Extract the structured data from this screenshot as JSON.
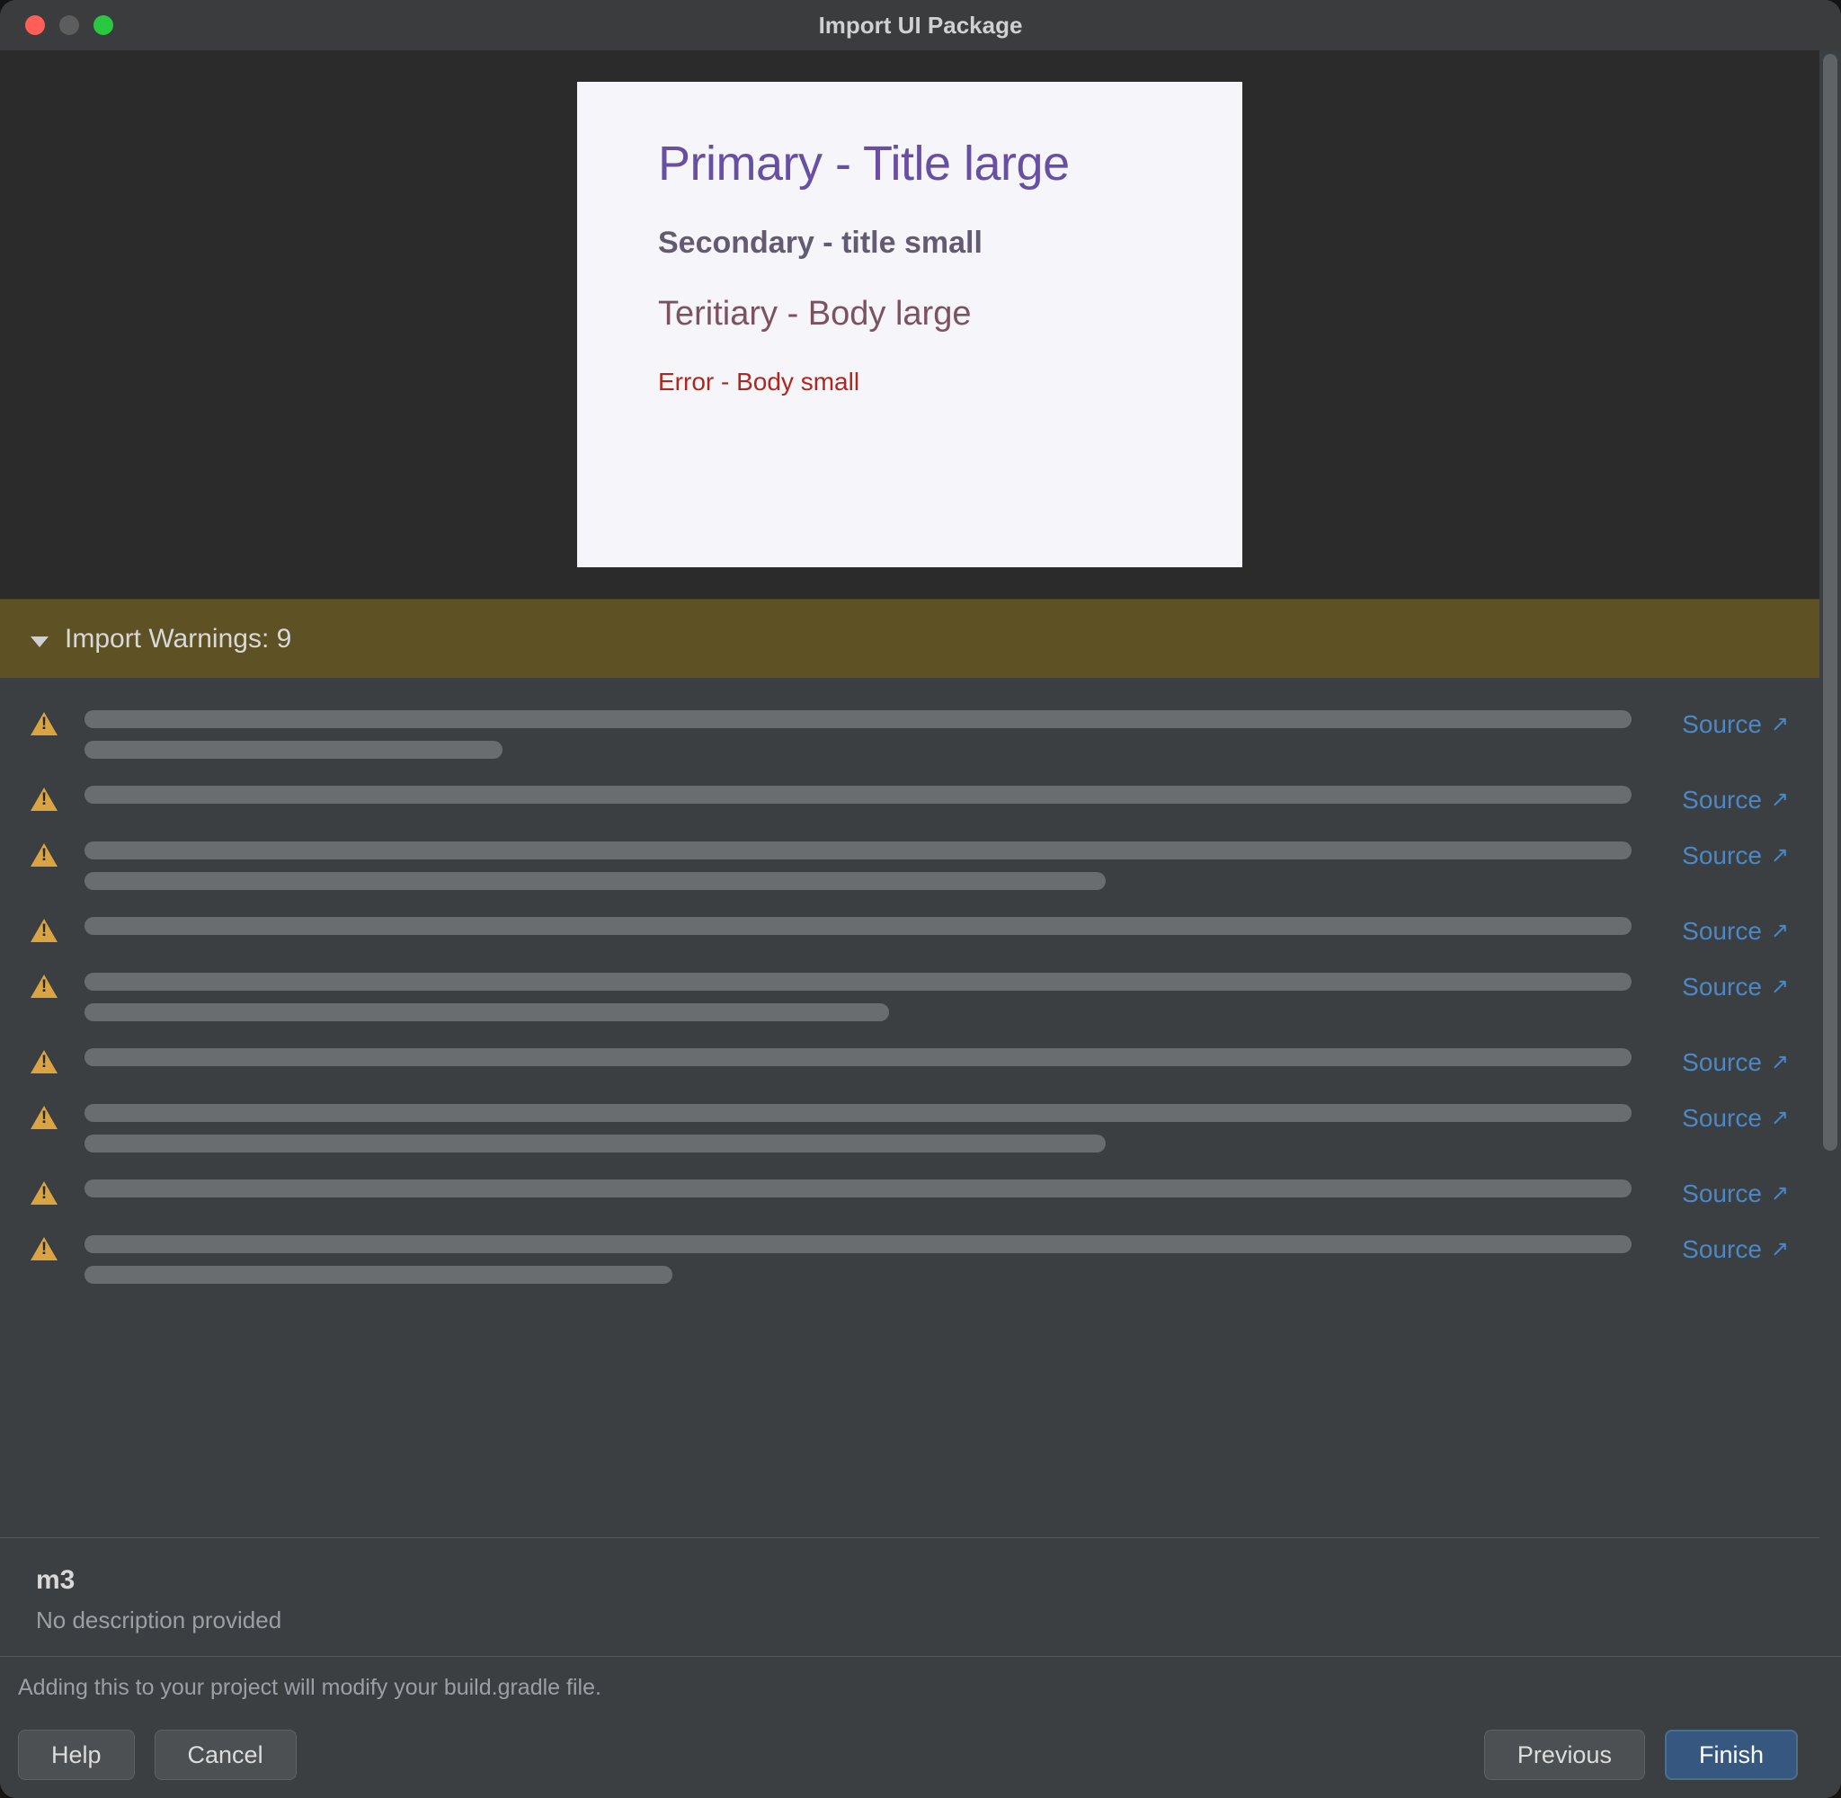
{
  "window": {
    "title": "Import UI Package"
  },
  "preview": {
    "primary": "Primary - Title large",
    "secondary": "Secondary - title small",
    "tertiary": "Teritiary - Body large",
    "error": "Error - Body small"
  },
  "warnings": {
    "banner_label": "Import Warnings: 9",
    "source_label": "Source",
    "items": [
      {
        "lines": [
          "rl-full",
          "rl-22"
        ]
      },
      {
        "lines": [
          "rl-full"
        ]
      },
      {
        "lines": [
          "rl-full",
          "rl-62"
        ]
      },
      {
        "lines": [
          "rl-full"
        ]
      },
      {
        "lines": [
          "rl-full",
          "rl-49"
        ]
      },
      {
        "lines": [
          "rl-full"
        ]
      },
      {
        "lines": [
          "rl-full",
          "rl-62"
        ]
      },
      {
        "lines": [
          "rl-full"
        ]
      },
      {
        "lines": [
          "rl-full",
          "rl-38"
        ]
      }
    ]
  },
  "package": {
    "name": "m3",
    "description": "No description provided"
  },
  "footer": {
    "note": "Adding this to your project will modify your build.gradle file.",
    "buttons": {
      "help": "Help",
      "cancel": "Cancel",
      "previous": "Previous",
      "finish": "Finish"
    }
  }
}
